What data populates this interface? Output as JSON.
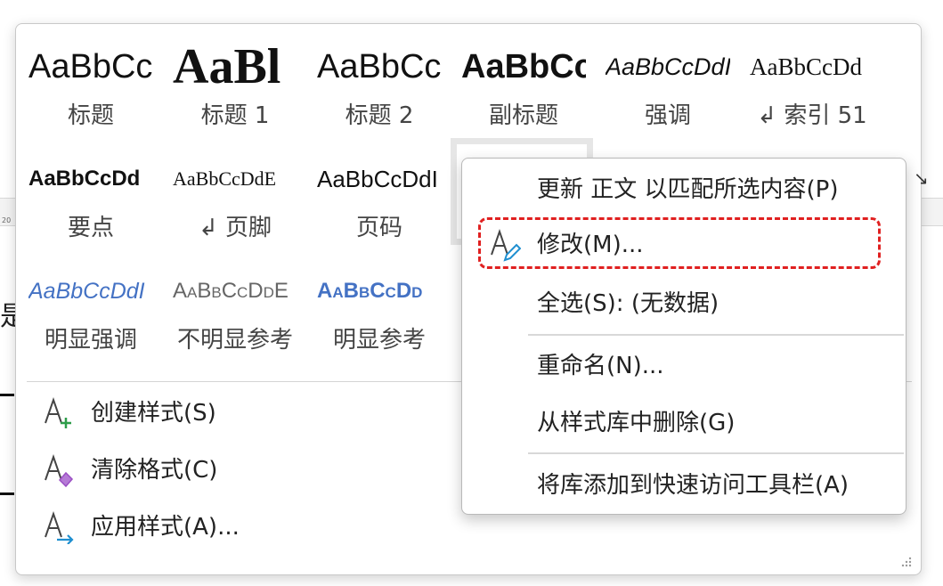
{
  "gallery": {
    "styles": [
      {
        "preview": "AaBbCc",
        "name": "标题"
      },
      {
        "preview": "AaBl",
        "name": "标题 1"
      },
      {
        "preview": "AaBbCc",
        "name": "标题 2"
      },
      {
        "preview": "AaBbCc",
        "name": "副标题"
      },
      {
        "preview": "AaBbCcDdI",
        "name": "强调"
      },
      {
        "preview": "AaBbCcDd",
        "name": "↲ 索引 51"
      },
      {
        "preview": "AaBbCcDd",
        "name": "要点"
      },
      {
        "preview": "AaBbCcDdE",
        "name": "↲ 页脚"
      },
      {
        "preview": "AaBbCcDdI",
        "name": "页码"
      },
      {
        "preview": "",
        "name": ""
      },
      {
        "preview": "AaBbCcDdI",
        "name": "明显强调"
      },
      {
        "preview": "AaBbCcDdE",
        "name": "不明显参考"
      },
      {
        "preview": "AaBbCcDd",
        "name": "明显参考"
      }
    ],
    "commands": [
      {
        "label": "创建样式(S)",
        "icon": "create-style-icon"
      },
      {
        "label": "清除格式(C)",
        "icon": "clear-formatting-icon"
      },
      {
        "label": "应用样式(A)...",
        "icon": "apply-styles-icon"
      }
    ]
  },
  "context_menu": {
    "items": [
      {
        "label": "更新 正文 以匹配所选内容(P)"
      },
      {
        "label": "修改(M)...",
        "icon": "modify-style-icon"
      },
      {
        "label": "全选(S): (无数据)"
      },
      {
        "label": "重命名(N)..."
      },
      {
        "label": "从样式库中删除(G)"
      },
      {
        "label": "将库添加到快速访问工具栏(A)"
      }
    ]
  },
  "background": {
    "ruler_number": "20",
    "doc_char": "是"
  },
  "colors": {
    "highlight": "#e02020",
    "accent_blue": "#4472c4",
    "icon_green": "#2e9d4a",
    "icon_purple": "#9b4fc4",
    "icon_cyan": "#1f8fd0"
  }
}
